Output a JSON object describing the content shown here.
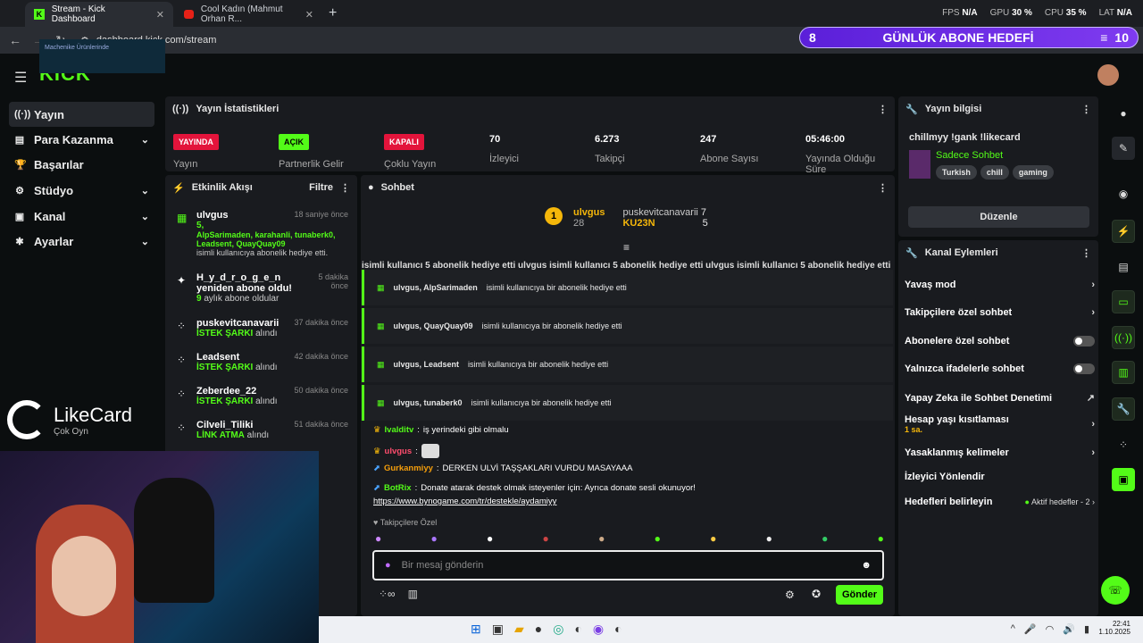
{
  "browser": {
    "tabs": [
      {
        "title": "Stream - Kick Dashboard",
        "active": true
      },
      {
        "title": "Cool Kadın (Mahmut Orhan R...",
        "active": false
      }
    ],
    "url": "dashboard.kick.com/stream",
    "perf": {
      "fps_label": "FPS",
      "fps": "N/A",
      "gpu_label": "GPU",
      "gpu": "30 %",
      "cpu_label": "CPU",
      "cpu": "35 %",
      "lat_label": "LAT",
      "lat": "N/A"
    }
  },
  "promo": {
    "count": "8",
    "text": "GÜNLÜK ABONE HEDEFİ",
    "viewers": "10"
  },
  "video_ad": "Machenike Ürünlerinde",
  "kick_logo": "KICK",
  "sidebar": {
    "items": [
      {
        "label": "Yayın",
        "icon": "broadcast-icon"
      },
      {
        "label": "Para Kazanma",
        "icon": "money-icon"
      },
      {
        "label": "Başarılar",
        "icon": "trophy-icon"
      },
      {
        "label": "Stüdyo",
        "icon": "gear-icon"
      },
      {
        "label": "Kanal",
        "icon": "channel-icon"
      },
      {
        "label": "Ayarlar",
        "icon": "settings-icon"
      }
    ]
  },
  "stats": {
    "title": "Yayın İstatistikleri",
    "items": [
      {
        "value": "YAYINDA",
        "label": "Yayın"
      },
      {
        "value": "AÇIK",
        "label": "Partnerlik Gelir"
      },
      {
        "value": "KAPALI",
        "label": "Çoklu Yayın"
      },
      {
        "value": "70",
        "label": "İzleyici"
      },
      {
        "value": "6.273",
        "label": "Takipçi"
      },
      {
        "value": "247",
        "label": "Abone Sayısı"
      },
      {
        "value": "05:46:00",
        "label": "Yayında Olduğu Süre"
      }
    ]
  },
  "activity": {
    "title": "Etkinlik Akışı",
    "filter": "Filtre",
    "items": [
      {
        "user": "ulvgus",
        "time": "18 saniye önce",
        "line1": "5,",
        "line2": "AlpSarimaden, karahanli, tunaberk0,",
        "line3": "Leadsent, QuayQuay09",
        "line4": "isimli kullanıcıya abonelik hediye etti."
      },
      {
        "user": "H_y_d_r_o_g_e_n yeniden abone oldu!",
        "time": "5 dakika önce",
        "line1": "9",
        "line2": "aylık abone oldular"
      },
      {
        "user": "puskevitcanavarii",
        "time": "37 dakika önce",
        "line1": "İSTEK ŞARKI",
        "line2": "alındı"
      },
      {
        "user": "Leadsent",
        "time": "42 dakika önce",
        "line1": "İSTEK ŞARKI",
        "line2": "alındı"
      },
      {
        "user": "Zeberdee_22",
        "time": "50 dakika önce",
        "line1": "İSTEK ŞARKI",
        "line2": "alındı"
      },
      {
        "user": "Cilveli_Tiliki",
        "time": "51 dakika önce",
        "line1": "LİNK ATMA",
        "line2": "alındı"
      }
    ]
  },
  "chat": {
    "title": "Sohbet",
    "top": [
      {
        "rank": "1",
        "user": "ulvgus",
        "count": "28"
      },
      {
        "user": "puskevitcanavarii",
        "count": "7"
      },
      {
        "user": "KU23N",
        "count": "5"
      }
    ],
    "ticker": "isimli kullanıcı 5 abonelik hediye etti  ulvgus isimli kullanıcı 5 abonelik hediye etti  ulvgus isimli kullanıcı 5 abonelik hediye etti",
    "gifts": [
      {
        "users": "ulvgus, AlpSarimaden",
        "text": "isimli kullanıcıya bir abonelik hediye etti"
      },
      {
        "users": "ulvgus, QuayQuay09",
        "text": "isimli kullanıcıya bir abonelik hediye etti"
      },
      {
        "users": "ulvgus, Leadsent",
        "text": "isimli kullanıcıya bir abonelik hediye etti"
      },
      {
        "users": "ulvgus, tunaberk0",
        "text": "isimli kullanıcıya bir abonelik hediye etti"
      }
    ],
    "messages": [
      {
        "user": "Ivalditv",
        "color": "#53fc18",
        "text": "iş yerindeki gibi olmalu"
      },
      {
        "user": "ulvgus",
        "color": "#ff4d6d",
        "text": ""
      },
      {
        "user": "Gurkanmiyy",
        "color": "#f59e0b",
        "text": "DERKEN ULVİ TAŞŞAKLARI VURDU MASAYAAA"
      },
      {
        "user": "BotRix",
        "color": "#53fc18",
        "text": "Donate atarak destek olmak isteyenler için: Ayrıca donate sesli okunuyor!"
      }
    ],
    "link": "https://www.bynogame.com/tr/destekle/aydamiyy",
    "followers_only": "Takipçilere Özel",
    "placeholder": "Bir mesaj gönderin",
    "send": "Gönder"
  },
  "info": {
    "title": "Yayın bilgisi",
    "stream_title": "chillmyy !gank !likecard",
    "category": "Sadece Sohbet",
    "tags": [
      "Turkish",
      "chill",
      "gaming"
    ],
    "edit": "Düzenle"
  },
  "channel_actions": {
    "title": "Kanal Eylemleri",
    "items": [
      {
        "label": "Yavaş mod",
        "kind": "chevron"
      },
      {
        "label": "Takipçilere özel sohbet",
        "kind": "chevron"
      },
      {
        "label": "Abonelere özel sohbet",
        "kind": "toggle"
      },
      {
        "label": "Yalnızca ifadelerle sohbet",
        "kind": "toggle"
      },
      {
        "label": "Yapay Zeka ile Sohbet Denetimi",
        "kind": "external"
      },
      {
        "label": "Hesap yaşı kısıtlaması",
        "sub": "1 sa.",
        "kind": "chevron"
      },
      {
        "label": "Yasaklanmış kelimeler",
        "kind": "chevron"
      },
      {
        "label": "İzleyici Yönlendir",
        "kind": "none"
      },
      {
        "label": "Hedefleri belirleyin",
        "extra": "Aktif hedefler - 2",
        "kind": "chevron"
      }
    ]
  },
  "likecard": {
    "name": "LikeCard",
    "sub": "Çok Oyn"
  },
  "taskbar": {
    "time": "22:41",
    "date": "1.10.2025"
  }
}
